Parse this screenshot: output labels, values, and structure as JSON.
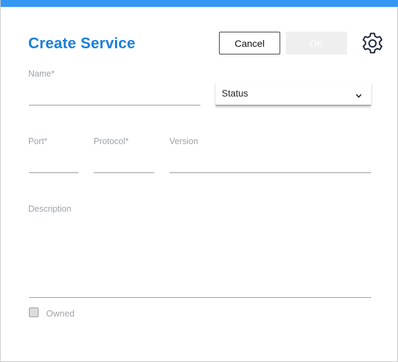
{
  "dialog": {
    "title": "Create Service",
    "cancel_label": "Cancel",
    "ok_label": "OK",
    "settings_icon": "gear-icon"
  },
  "form": {
    "name": {
      "label": "Name*",
      "value": ""
    },
    "status": {
      "selected": "Status",
      "icon": "chevron-down-icon"
    },
    "port": {
      "label": "Port*",
      "value": ""
    },
    "protocol": {
      "label": "Protocol*",
      "value": ""
    },
    "version": {
      "label": "Version",
      "value": ""
    },
    "description": {
      "label": "Description",
      "value": ""
    },
    "owned": {
      "label": "Owned",
      "checked": false
    }
  },
  "colors": {
    "accent": "#3497f3",
    "title": "#1a7fdc",
    "label": "#9ea2a8",
    "ok_disabled_bg": "#efefef"
  }
}
